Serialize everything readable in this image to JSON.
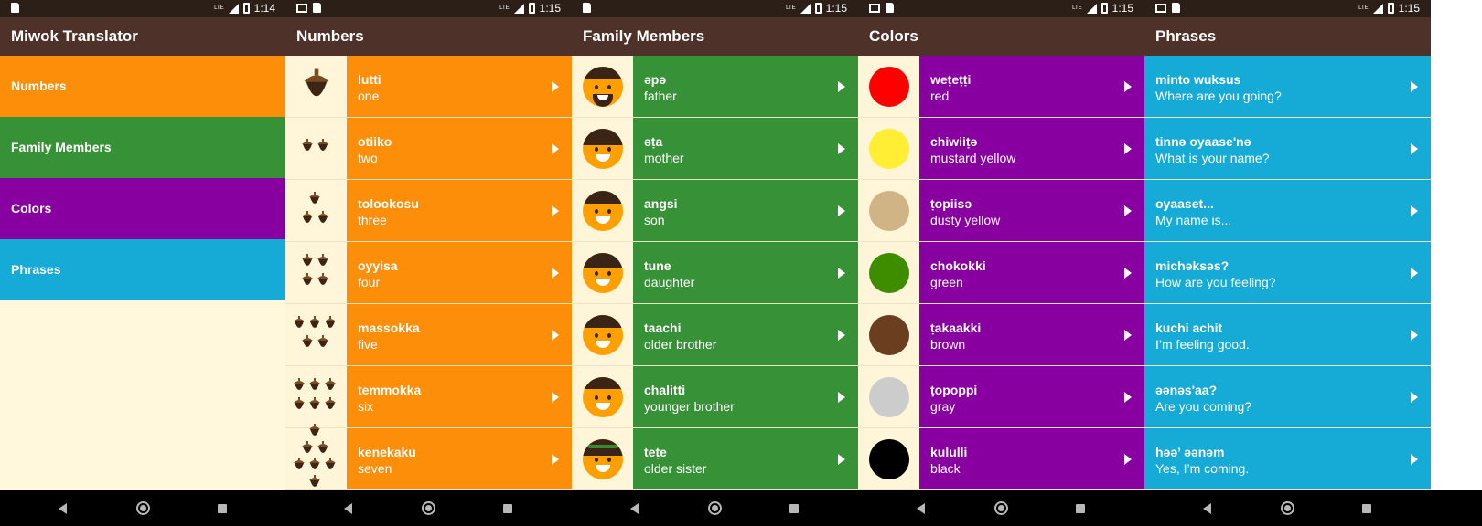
{
  "status_times": [
    "1:14",
    "1:15",
    "1:15",
    "1:15",
    "1:15"
  ],
  "main": {
    "title": "Miwok Translator",
    "categories": [
      {
        "label": "Numbers",
        "color": "#fd8e09"
      },
      {
        "label": "Family Members",
        "color": "#379237"
      },
      {
        "label": "Colors",
        "color": "#8800a0"
      },
      {
        "label": "Phrases",
        "color": "#16aad6"
      }
    ]
  },
  "numbers": {
    "title": "Numbers",
    "color": "#fd8e09",
    "items": [
      {
        "miwok": "lutti",
        "english": "one",
        "icon": "acorn-icon",
        "count": 1
      },
      {
        "miwok": "otiiko",
        "english": "two",
        "icon": "acorn-icon",
        "count": 2
      },
      {
        "miwok": "tolookosu",
        "english": "three",
        "icon": "acorn-icon",
        "count": 3
      },
      {
        "miwok": "oyyisa",
        "english": "four",
        "icon": "acorn-icon",
        "count": 4
      },
      {
        "miwok": "massokka",
        "english": "five",
        "icon": "acorn-icon",
        "count": 5
      },
      {
        "miwok": "temmokka",
        "english": "six",
        "icon": "acorn-icon",
        "count": 6
      },
      {
        "miwok": "kenekaku",
        "english": "seven",
        "icon": "acorn-icon",
        "count": 7
      }
    ]
  },
  "family": {
    "title": "Family Members",
    "color": "#379237",
    "items": [
      {
        "miwok": "əpə",
        "english": "father",
        "icon": "father-face-icon"
      },
      {
        "miwok": "əṭa",
        "english": "mother",
        "icon": "mother-face-icon"
      },
      {
        "miwok": "angsi",
        "english": "son",
        "icon": "son-face-icon"
      },
      {
        "miwok": "tune",
        "english": "daughter",
        "icon": "daughter-face-icon"
      },
      {
        "miwok": "taachi",
        "english": "older brother",
        "icon": "older-brother-face-icon"
      },
      {
        "miwok": "chalitti",
        "english": "younger brother",
        "icon": "younger-brother-face-icon"
      },
      {
        "miwok": "teṭe",
        "english": "older sister",
        "icon": "older-sister-face-icon"
      }
    ]
  },
  "colors": {
    "title": "Colors",
    "color": "#8800a0",
    "items": [
      {
        "miwok": "weṭeṭṭi",
        "english": "red",
        "swatch": "#ff0000"
      },
      {
        "miwok": "chiwiiṭə",
        "english": "mustard yellow",
        "swatch": "#ffee33"
      },
      {
        "miwok": "ṭopiisə",
        "english": "dusty yellow",
        "swatch": "#d1b486"
      },
      {
        "miwok": "chokokki",
        "english": "green",
        "swatch": "#3e8c00"
      },
      {
        "miwok": "ṭakaakki",
        "english": "brown",
        "swatch": "#6a3e1f"
      },
      {
        "miwok": "ṭopoppi",
        "english": "gray",
        "swatch": "#cccccc"
      },
      {
        "miwok": "kululli",
        "english": "black",
        "swatch": "#000000"
      }
    ]
  },
  "phrases": {
    "title": "Phrases",
    "color": "#16aad6",
    "items": [
      {
        "miwok": "minto wuksus",
        "english": "Where are you going?"
      },
      {
        "miwok": "tinnә oyaase'nә",
        "english": "What is your name?"
      },
      {
        "miwok": "oyaaset...",
        "english": "My name is..."
      },
      {
        "miwok": "michәksәs?",
        "english": "How are you feeling?"
      },
      {
        "miwok": "kuchi achit",
        "english": "I’m feeling good."
      },
      {
        "miwok": "әәnәs'aa?",
        "english": "Are you coming?"
      },
      {
        "miwok": "hәә’ әәnәm",
        "english": "Yes, I’m coming."
      }
    ]
  }
}
